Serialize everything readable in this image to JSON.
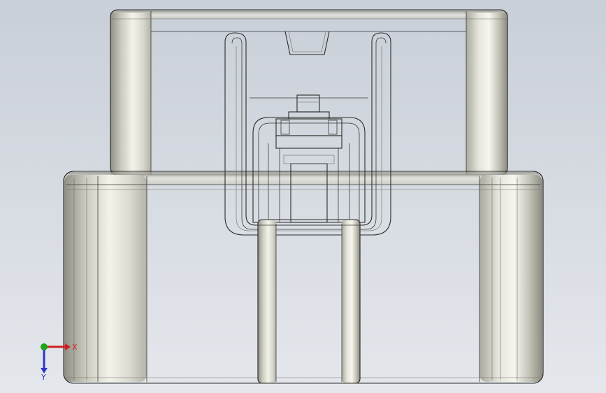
{
  "viewport": {
    "background_top": "#c9cfd8",
    "background_bottom": "#e4e7ec",
    "model_face_color": "#cfcfc4",
    "model_shadow_color": "#9d9d91",
    "model_highlight_color": "#f4f4ec"
  },
  "triad": {
    "x_label": "X",
    "y_label": "Y",
    "x_color": "#d01f1f",
    "y_color": "#2a35c8",
    "z_color": "#1aa51a"
  }
}
